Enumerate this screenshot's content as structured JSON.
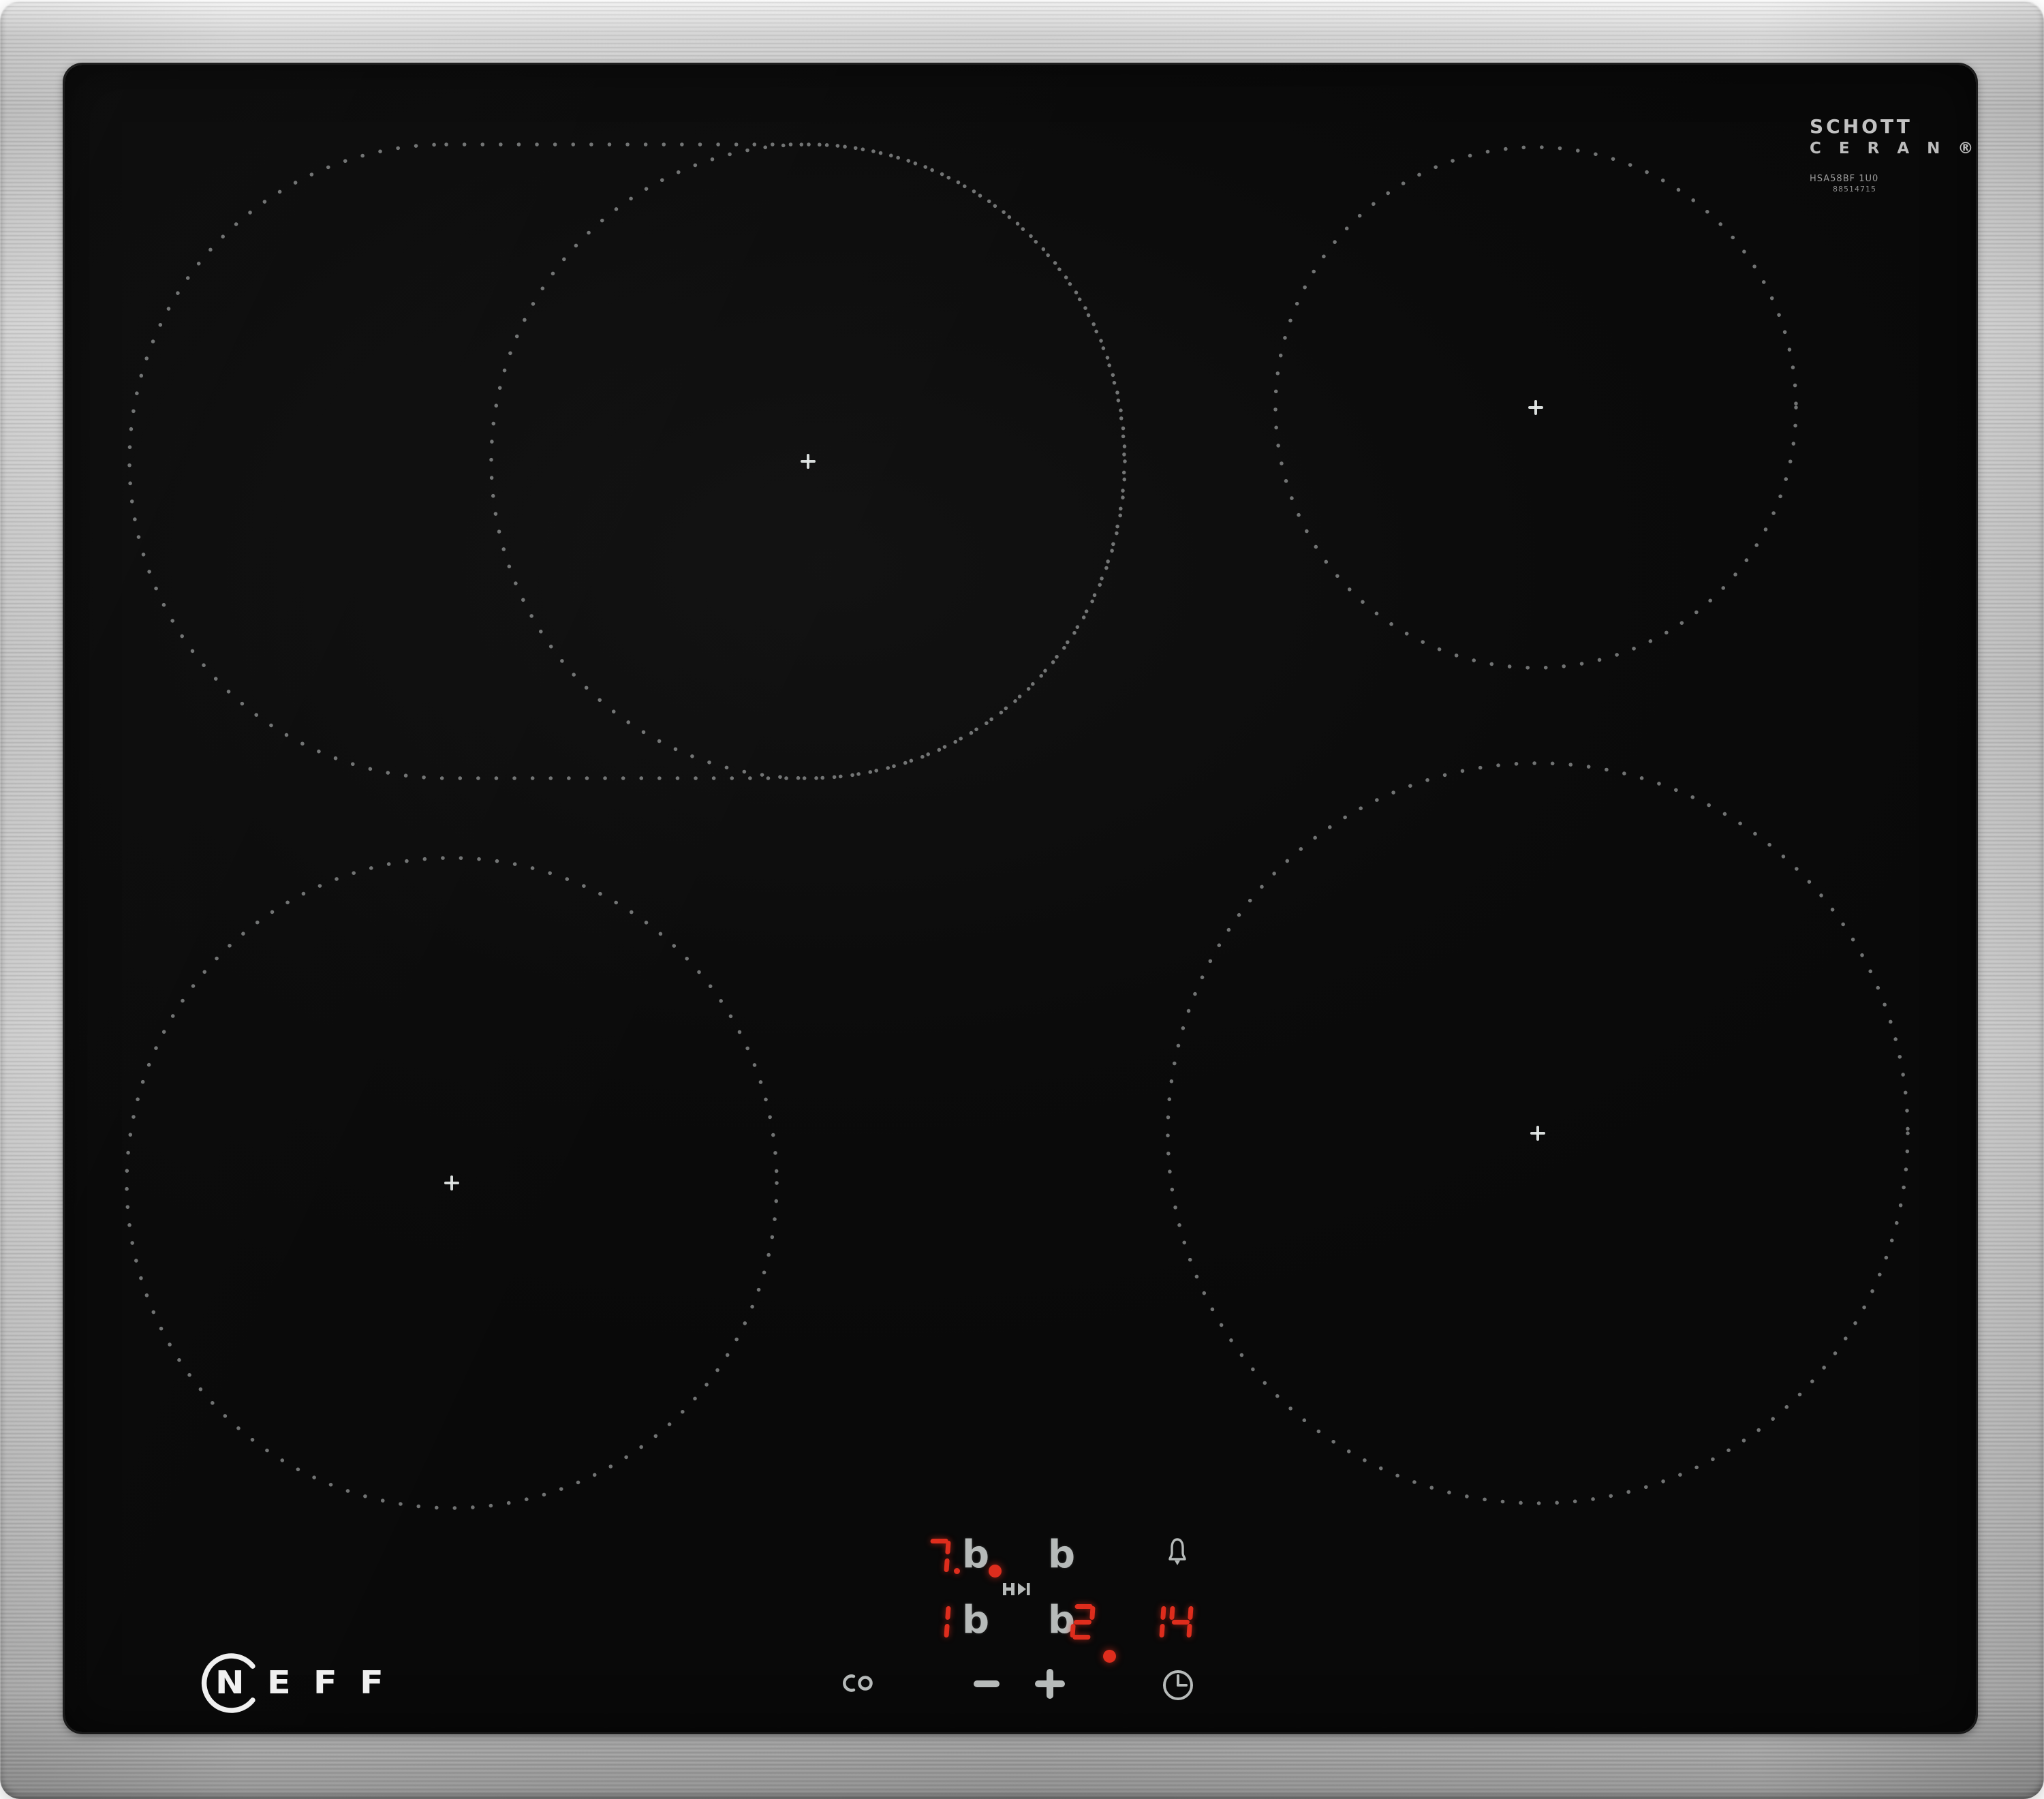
{
  "device": {
    "brand": "NEFF"
  },
  "glass_branding": {
    "maker_line1": "SCHOTT",
    "maker_line2": "C E R A N ®",
    "small_print_line1": "HSA58BF 1U0",
    "small_print_line2": "88514715"
  },
  "display": {
    "rear_left_level": "7.",
    "front_left_level": "1",
    "front_right_level": "2",
    "timer_minutes": "14",
    "zone_marker_glyph": "b"
  },
  "indicators": {
    "lock_indicator_icon": "key-icon",
    "lock_indicator_led": "on",
    "alarm_icon": "bell-icon",
    "timer_zone_led": "on"
  },
  "controls": {
    "lock_button_icon": "key-icon",
    "decrease_icon": "minus-icon",
    "increase_icon": "plus-icon",
    "timer_button_icon": "clock-icon"
  },
  "colors": {
    "led_red": "#de2d1d",
    "symbol_gray": "#b6bab9",
    "zone_dot_gray": "#c7cbca",
    "glass_black": "#0b0b0b",
    "logo_white": "#f0f0f0"
  }
}
